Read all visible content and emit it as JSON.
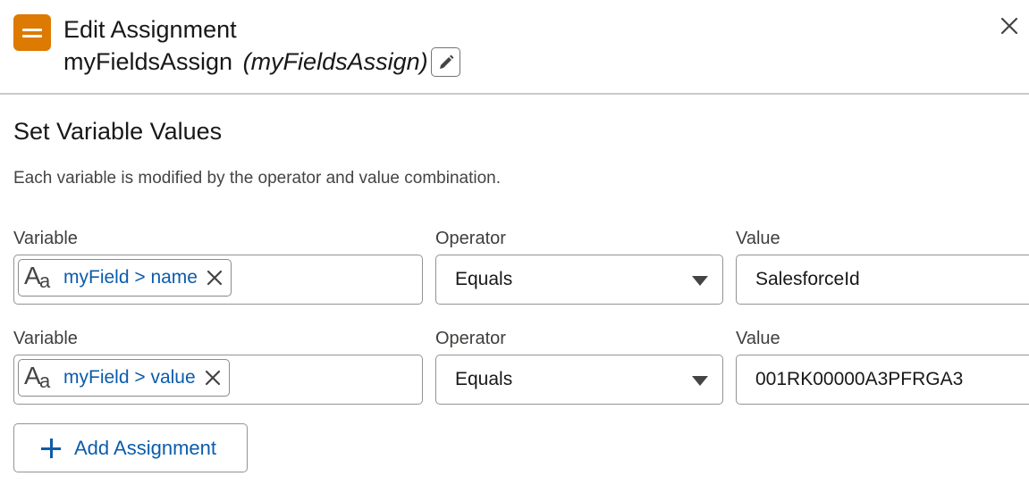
{
  "header": {
    "title": "Edit Assignment",
    "label": "myFieldsAssign",
    "api_name": "(myFieldsAssign)",
    "icon": "assignment-icon",
    "icon_color": "#dd7a01"
  },
  "section": {
    "title": "Set Variable Values",
    "description": "Each variable is modified by the operator and value combination."
  },
  "rows": [
    {
      "variable_label": "Variable",
      "variable_value": "myField > name",
      "operator_label": "Operator",
      "operator_value": "Equals",
      "value_label": "Value",
      "value_value": "SalesforceId"
    },
    {
      "variable_label": "Variable",
      "variable_value": "myField > value",
      "operator_label": "Operator",
      "operator_value": "Equals",
      "value_label": "Value",
      "value_value": "001RK00000A3PFRGA3"
    }
  ],
  "actions": {
    "add_assignment": "Add Assignment"
  },
  "colors": {
    "accent": "#0b5cab",
    "border": "#939393"
  }
}
